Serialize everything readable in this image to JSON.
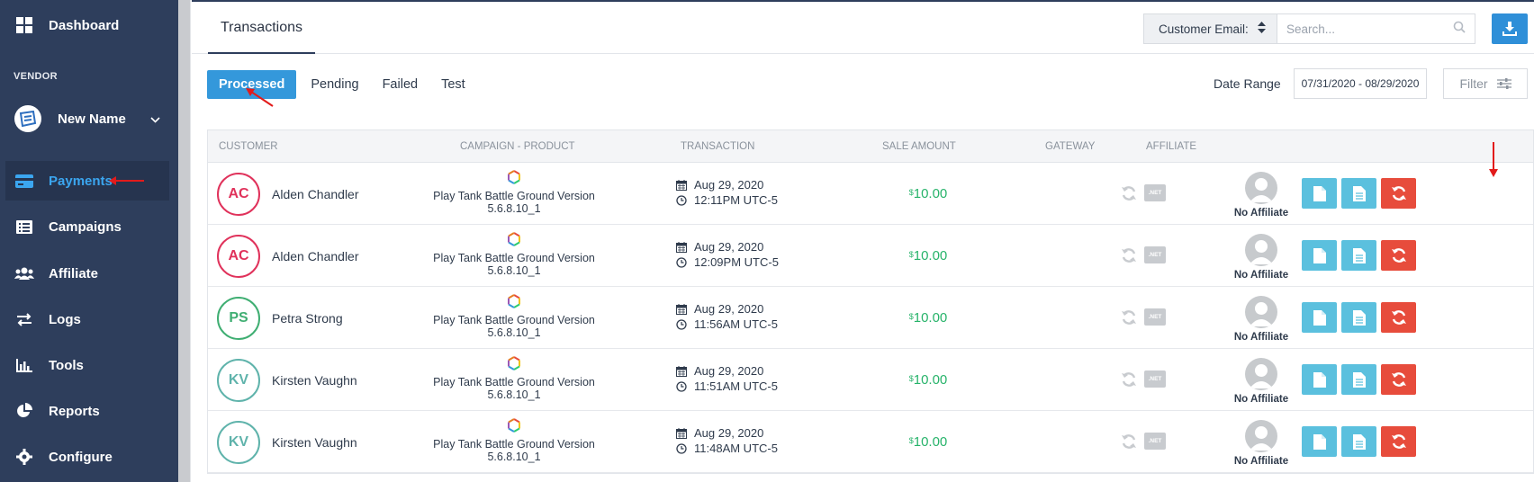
{
  "sidebar": {
    "items_top": [
      {
        "label": "Dashboard",
        "icon": "dashboard-icon"
      }
    ],
    "section_label": "VENDOR",
    "vendor_name": "New Name",
    "items": [
      {
        "label": "Payments",
        "icon": "credit-card-icon",
        "active": true
      },
      {
        "label": "Campaigns",
        "icon": "list-icon",
        "active": false
      },
      {
        "label": "Affiliate",
        "icon": "users-icon",
        "active": false
      },
      {
        "label": "Logs",
        "icon": "exchange-icon",
        "active": false
      },
      {
        "label": "Tools",
        "icon": "bar-chart-icon",
        "active": false
      },
      {
        "label": "Reports",
        "icon": "pie-chart-icon",
        "active": false
      },
      {
        "label": "Configure",
        "icon": "gear-icon",
        "active": false
      }
    ]
  },
  "header": {
    "page_tab": "Transactions",
    "search_field_select": "Customer Email:",
    "search_placeholder": "Search...",
    "download_icon": "download-icon"
  },
  "filters": {
    "tabs": [
      "Processed",
      "Pending",
      "Failed",
      "Test"
    ],
    "active_tab": "Processed",
    "date_range_label": "Date Range",
    "date_range_value": "07/31/2020 - 08/29/2020",
    "filter_label": "Filter"
  },
  "table": {
    "columns": [
      "Customer",
      "Campaign - Product",
      "Transaction",
      "Sale Amount",
      "Gateway",
      "Affiliate"
    ],
    "rows": [
      {
        "initials": "AC",
        "name": "Alden Chandler",
        "product": "Play Tank Battle Ground Version 5.6.8.10_1",
        "date": "Aug 29, 2020",
        "time": "12:11PM UTC-5",
        "currency": "$",
        "amount": "10.00",
        "gateway": ".NET",
        "affiliate": "No Affiliate",
        "color": "#e0325b"
      },
      {
        "initials": "AC",
        "name": "Alden Chandler",
        "product": "Play Tank Battle Ground Version 5.6.8.10_1",
        "date": "Aug 29, 2020",
        "time": "12:09PM UTC-5",
        "currency": "$",
        "amount": "10.00",
        "gateway": ".NET",
        "affiliate": "No Affiliate",
        "color": "#e0325b"
      },
      {
        "initials": "PS",
        "name": "Petra Strong",
        "product": "Play Tank Battle Ground Version 5.6.8.10_1",
        "date": "Aug 29, 2020",
        "time": "11:56AM UTC-5",
        "currency": "$",
        "amount": "10.00",
        "gateway": ".NET",
        "affiliate": "No Affiliate",
        "color": "#3fae72"
      },
      {
        "initials": "KV",
        "name": "Kirsten Vaughn",
        "product": "Play Tank Battle Ground Version 5.6.8.10_1",
        "date": "Aug 29, 2020",
        "time": "11:51AM UTC-5",
        "currency": "$",
        "amount": "10.00",
        "gateway": ".NET",
        "affiliate": "No Affiliate",
        "color": "#5fb3ab"
      },
      {
        "initials": "KV",
        "name": "Kirsten Vaughn",
        "product": "Play Tank Battle Ground Version 5.6.8.10_1",
        "date": "Aug 29, 2020",
        "time": "11:48AM UTC-5",
        "currency": "$",
        "amount": "10.00",
        "gateway": ".NET",
        "affiliate": "No Affiliate",
        "color": "#5fb3ab"
      }
    ]
  },
  "colors": {
    "sidebar_bg": "#2e3e5c",
    "accent_blue": "#3498db",
    "amount_green": "#27b36a",
    "action_blue": "#5bc0de",
    "action_red": "#e74c3c",
    "annotation_red": "#e21b1b"
  }
}
